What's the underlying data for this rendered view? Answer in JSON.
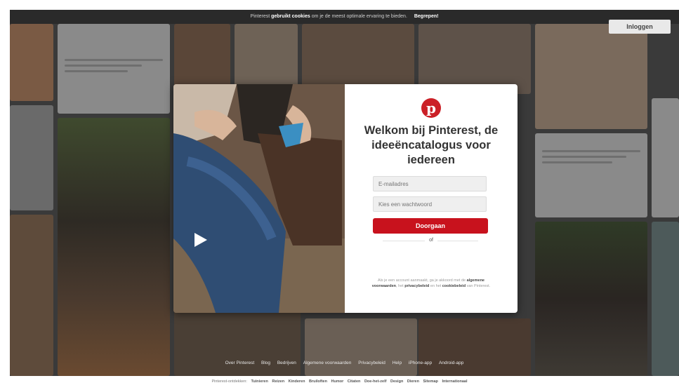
{
  "cookie_bar": {
    "prefix": "Pinterest",
    "bold": "gebruikt cookies",
    "suffix": "om je de meest optimale ervaring te bieden.",
    "ack_label": "Begrepen!"
  },
  "header": {
    "login_label": "Inloggen"
  },
  "modal": {
    "logo_glyph": "p",
    "title": "Welkom bij Pinterest, de ideeëncatalogus voor iedereen",
    "email_placeholder": "E-mailadres",
    "password_placeholder": "Kies een wachtwoord",
    "continue_label": "Doorgaan",
    "or_label": "of",
    "legal_prefix": "Als je een account aanmaakt, ga je akkoord met de",
    "terms_label": "algemene voorwaarden",
    "legal_mid": ", het",
    "privacy_label": "privacybeleid",
    "legal_and": "en het",
    "cookie_label": "cookiebeleid",
    "legal_suffix": "van Pinterest."
  },
  "bottom_links": [
    "Over Pinterest",
    "Blog",
    "Bedrijven",
    "Algemene voorwaarden",
    "Privacybeleid",
    "Help",
    "iPhone-app",
    "Android-app"
  ],
  "footer": {
    "label": "Pinterest-ontdekken:",
    "items": [
      "Tuinieren",
      "Reizen",
      "Kinderen",
      "Bruiloften",
      "Humor",
      "Citaten",
      "Doe-het-zelf",
      "Design",
      "Dieren",
      "Sitemap",
      "Internationaal"
    ]
  },
  "colors": {
    "brand_red": "#cb2027",
    "button_red": "#c8121d",
    "overlay": "#3a3a3a"
  }
}
